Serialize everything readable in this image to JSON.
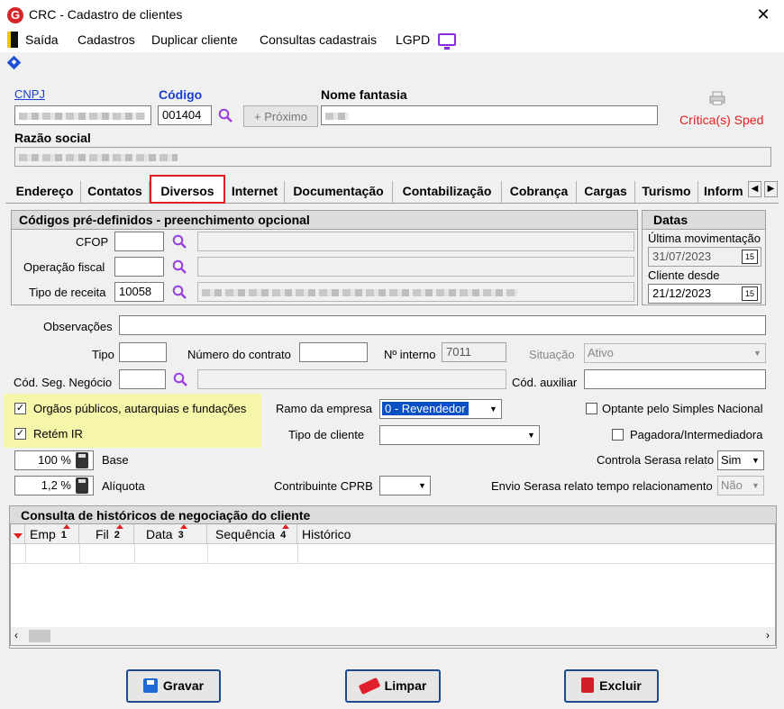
{
  "window": {
    "title": "CRC - Cadastro de clientes",
    "close": "✕",
    "logo": "G"
  },
  "menu": {
    "exit": "Saída",
    "cadastros": "Cadastros",
    "duplicar": "Duplicar cliente",
    "consultas": "Consultas cadastrais",
    "lgpd": "LGPD"
  },
  "header": {
    "cnpj_label": "CNPJ",
    "codigo_label": "Código",
    "codigo_value": "001404",
    "proximo": "Próximo",
    "nome_fantasia_label": "Nome fantasia",
    "razao_social_label": "Razão social",
    "critica_sped": "Crítica(s) Sped"
  },
  "tabs": [
    "Endereço",
    "Contatos",
    "Diversos",
    "Internet",
    "Documentação",
    "Contabilização",
    "Cobrança",
    "Cargas",
    "Turismo",
    "Inform"
  ],
  "codigos_group": {
    "title": "Códigos pré-definidos - preenchimento opcional",
    "cfop_label": "CFOP",
    "operacao_label": "Operação fiscal",
    "tipo_receita_label": "Tipo de receita",
    "tipo_receita_value": "10058"
  },
  "datas_group": {
    "title": "Datas",
    "ultima_label": "Última movimentação",
    "ultima_value": "31/07/2023",
    "cliente_desde_label": "Cliente desde",
    "cliente_desde_value": "21/12/2023",
    "cal_icon": "15"
  },
  "form": {
    "observacoes_label": "Observações",
    "tipo_label": "Tipo",
    "numero_contrato_label": "Número do contrato",
    "n_interno_label": "Nº interno",
    "n_interno_value": "7011",
    "situacao_label": "Situação",
    "situacao_value": "Ativo",
    "cod_seg_label": "Cód. Seg. Negócio",
    "cod_auxiliar_label": "Cód. auxiliar",
    "orgaos_label": "Orgãos públicos, autarquias e fundações",
    "retem_label": "Retém IR",
    "check_mark": "✓",
    "ramo_label": "Ramo da empresa",
    "ramo_value": "0 - Revendedor",
    "tipo_cliente_label": "Tipo de cliente",
    "optante_label": "Optante pelo Simples Nacional",
    "pagadora_label": "Pagadora/Intermediadora",
    "base_value": "100 %",
    "base_label": "Base",
    "aliquota_value": "1,2 %",
    "aliquota_label": "Alíquota",
    "contribuinte_label": "Contribuinte CPRB",
    "controla_label": "Controla Serasa relato",
    "controla_value": "Sim",
    "envio_label": "Envio Serasa relato tempo relacionamento",
    "envio_value": "Não"
  },
  "grid": {
    "title": "Consulta de históricos de negociação do cliente",
    "columns": [
      {
        "label": "Emp",
        "sort": "1"
      },
      {
        "label": "Fil",
        "sort": "2"
      },
      {
        "label": "Data",
        "sort": "3"
      },
      {
        "label": "Sequência",
        "sort": "4"
      },
      {
        "label": "Histórico",
        "sort": ""
      }
    ]
  },
  "buttons": {
    "gravar": "Gravar",
    "limpar": "Limpar",
    "excluir": "Excluir"
  }
}
